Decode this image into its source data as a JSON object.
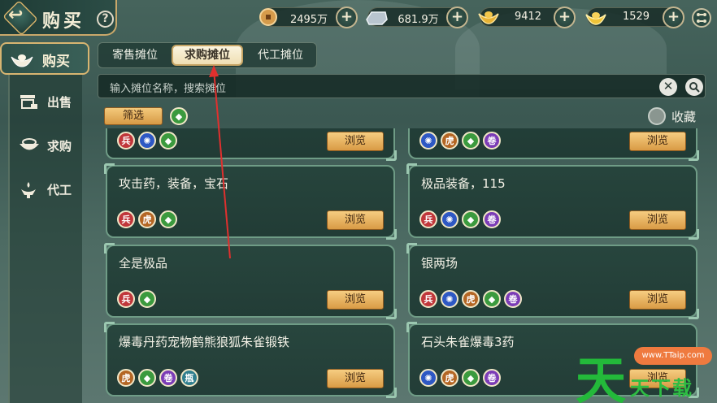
{
  "header": {
    "title": "购买"
  },
  "currencies": [
    {
      "icon": "coin-icon",
      "value": "2495万"
    },
    {
      "icon": "silver-ingot-icon",
      "value": "681.9万"
    },
    {
      "icon": "gold-ingot-icon",
      "value": "9412"
    },
    {
      "icon": "yuanbao-icon",
      "value": "1529"
    }
  ],
  "sidebar": {
    "buy_tab": "购买",
    "items": [
      {
        "label": "出售",
        "icon": "stall-icon"
      },
      {
        "label": "求购",
        "icon": "bowl-icon"
      },
      {
        "label": "代工",
        "icon": "lamp-icon"
      }
    ]
  },
  "tabs": [
    {
      "label": "寄售摊位"
    },
    {
      "label": "求购摊位"
    },
    {
      "label": "代工摊位"
    }
  ],
  "search": {
    "placeholder": "输入摊位名称，搜索摊位"
  },
  "filter": {
    "label": "筛选",
    "favorite_label": "收藏"
  },
  "browse_label": "浏览",
  "cards": [
    {
      "title": "",
      "icons": [
        "red",
        "blue",
        "green"
      ]
    },
    {
      "title": "",
      "icons": [
        "blue",
        "orange",
        "green",
        "purple"
      ]
    },
    {
      "title": "攻击药，装备，宝石",
      "icons": [
        "red",
        "orange",
        "green"
      ]
    },
    {
      "title": "极品装备，115",
      "icons": [
        "red",
        "blue",
        "green",
        "purple"
      ]
    },
    {
      "title": "全是极品",
      "icons": [
        "red",
        "green"
      ]
    },
    {
      "title": "银两场",
      "icons": [
        "red",
        "blue",
        "orange",
        "green",
        "purple"
      ]
    },
    {
      "title": "爆毒丹药宠物鹤熊狼狐朱雀锻铁",
      "icons": [
        "orange",
        "green",
        "purple",
        "teal"
      ]
    },
    {
      "title": "石头朱雀爆毒3药",
      "icons": [
        "blue",
        "orange",
        "green",
        "purple"
      ]
    }
  ],
  "watermark": {
    "big": "天",
    "pill": "www.TTaip.com",
    "small": "天下载"
  }
}
